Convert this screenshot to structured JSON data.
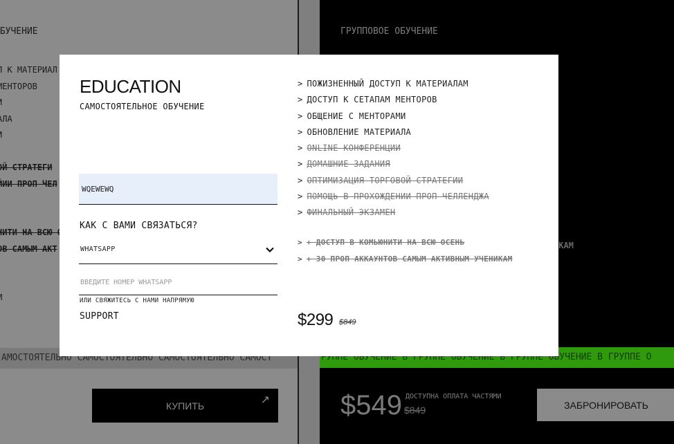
{
  "background": {
    "left": {
      "heading": "ОБУЧЕНИЕ",
      "features": [
        {
          "label": "П К МАТЕРИАЛ",
          "struck": false
        },
        {
          "label": "МЕНТОРОВ",
          "struck": false
        },
        {
          "label": "И",
          "struck": false
        },
        {
          "label": "АЛА",
          "struck": false
        },
        {
          "label": "И",
          "struck": false
        },
        {
          "label": "",
          "struck": false
        },
        {
          "label": "ОЙ СТРАТЕГИ",
          "struck": true
        },
        {
          "label": "ЙИИ ПРОП ЧЕЛ",
          "struck": true
        },
        {
          "label": "",
          "struck": false
        },
        {
          "label": "",
          "struck": false
        },
        {
          "label": "НИТИ НА ВСЮ О",
          "struck": true
        },
        {
          "label": "ОВ САМЫМ АКТ",
          "struck": true
        },
        {
          "label": "",
          "struck": false
        },
        {
          "label": "",
          "struck": false
        },
        {
          "label": "М",
          "struck": false
        }
      ],
      "ticker": "АМОСТОЯТЕЛЬНО САМОСТОЯТЕЛЬНО САМОСТОЯТЕЛЬНО САМОСТ",
      "buy_label": "КУПИТЬ",
      "buy_arrow": "↗"
    },
    "right": {
      "heading": "ГРУППОВОЕ ОБУЧЕНИЕ",
      "mentor_fragment": "ИКАМ",
      "ticker": "РУППЕ ОБУЧЕНИЕ В ГРУППЕ ОБУЧЕНИЕ В ГРУППЕ ОБУЧЕНИЕ В ГРУППЕ О",
      "price": "$549",
      "old_price": "$849",
      "installments": "ДОСТУПНА ОПЛАТА ЧАСТЯМИ",
      "reserve_label": "ЗАБРОНИРОВАТЬ"
    }
  },
  "modal": {
    "title": "EDUCATION",
    "subtitle": "САМОСТОЯТЕЛЬНОЕ ОБУЧЕНИЕ",
    "name_value": "WQEWEWQ",
    "contact_label": "КАК С ВАМИ СВЯЗАТЬСЯ?",
    "messenger": "WHATSAPP",
    "phone_placeholder": "ВВЕДИТЕ НОМЕР WHATSAPP",
    "direct_label": "ИЛИ СВЯЖИТЕСЬ С НАМИ НАПРЯМУЮ",
    "support_label": "SUPPORT",
    "chevron_glyph": ">",
    "features": [
      {
        "label": "ПОЖИЗНЕННЫЙ ДОСТУП К МАТЕРИАЛАМ",
        "included": true
      },
      {
        "label": "ДОСТУП К СЕТАПАМ МЕНТОРОВ",
        "included": true
      },
      {
        "label": "ОБЩЕНИЕ С МЕНТОРАМИ",
        "included": true
      },
      {
        "label": "ОБНОВЛЕНИЕ МАТЕРИАЛА",
        "included": true
      },
      {
        "label": "ONLINE КОНФЕРЕНЦИИ",
        "included": false
      },
      {
        "label": "ДОМАШНИЕ ЗАДАНИЯ",
        "included": false
      },
      {
        "label": "ОПТИМИЗАЦИЯ ТОРГОВОЙ СТРАТЕГИИ",
        "included": false
      },
      {
        "label": "ПОМОЩЬ В ПРОХОЖДЕНИИ ПРОП ЧЕЛЛЕНДЖА",
        "included": false
      },
      {
        "label": "ФИНАЛЬНЫЙ ЭКЗАМЕН",
        "included": false
      }
    ],
    "bonuses": [
      {
        "label": "+ ДОСТУП В КОМЬЮНИТИ НА ВСЮ ОСЕНЬ"
      },
      {
        "label": "+ 30 ПРОП АККАУНТОВ САМЫМ АКТИВНЫМ УЧЕНИКАМ"
      }
    ],
    "price": "$299",
    "old_price": "$849"
  }
}
